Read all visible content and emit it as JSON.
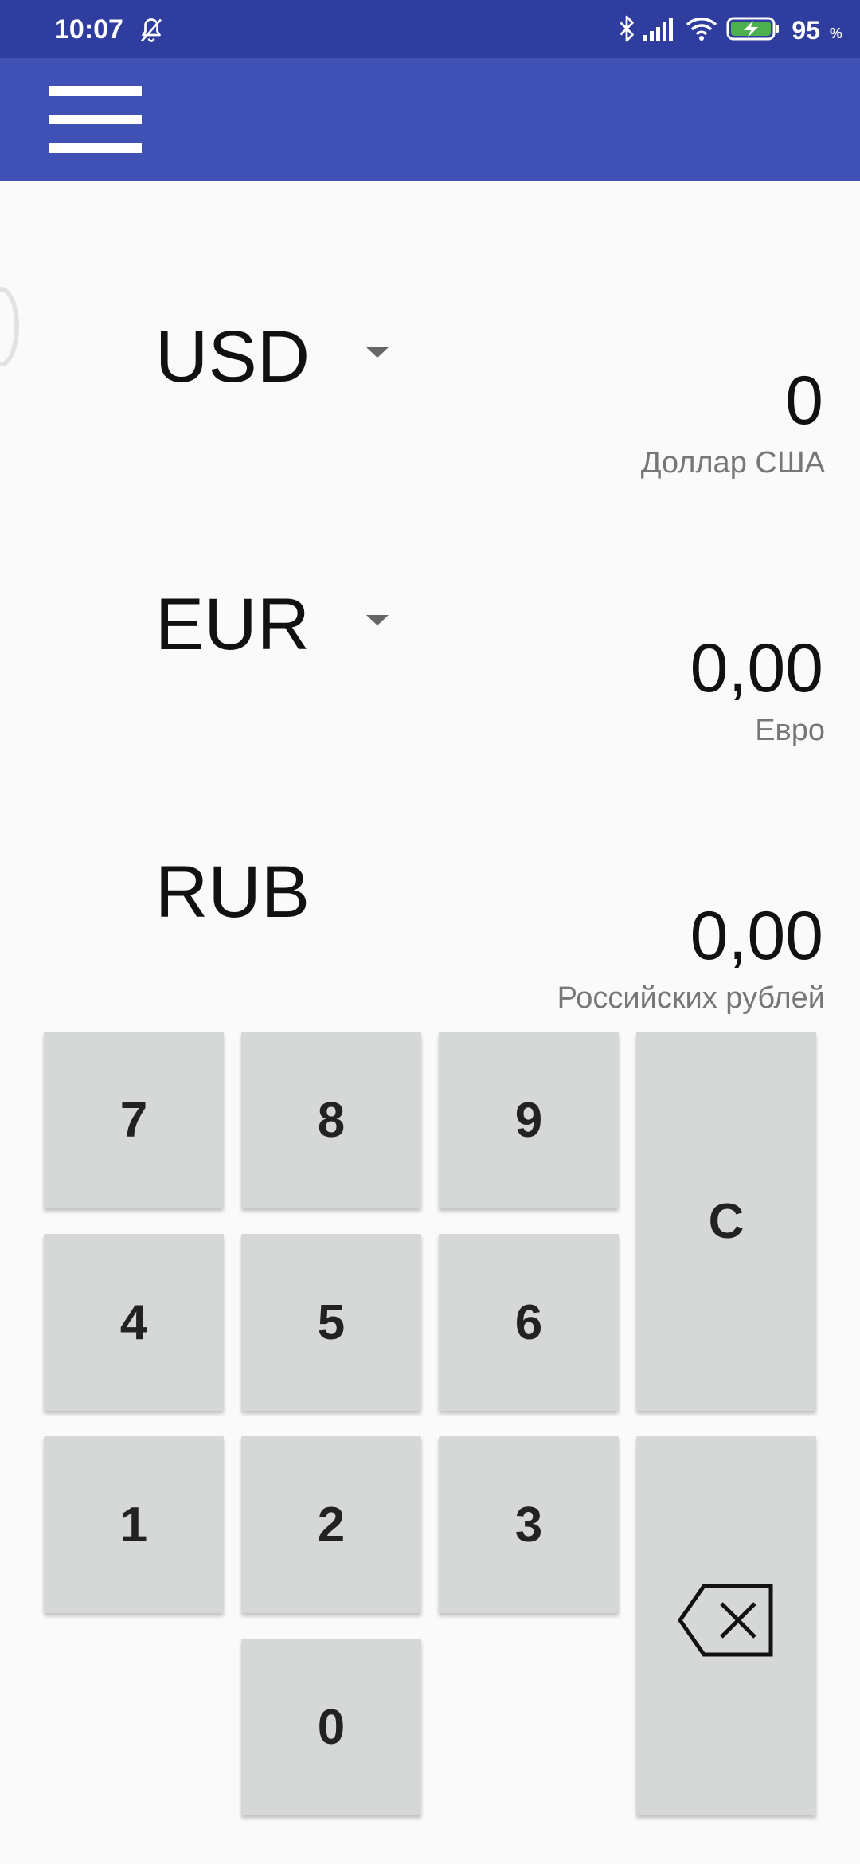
{
  "status_bar": {
    "time": "10:07",
    "battery_percent": "95",
    "battery_percent_sign": "%",
    "icons": [
      "bell-off-icon",
      "bluetooth-icon",
      "signal-icon",
      "wifi-icon",
      "battery-charging-icon"
    ]
  },
  "toolbar": {
    "menu_icon": "hamburger-menu-icon"
  },
  "currencies": [
    {
      "code": "USD",
      "amount": "0",
      "name": "Доллар США",
      "has_dropdown": true
    },
    {
      "code": "EUR",
      "amount": "0,00",
      "name": "Евро",
      "has_dropdown": true
    },
    {
      "code": "RUB",
      "amount": "0,00",
      "name": "Российских рублей",
      "has_dropdown": false
    }
  ],
  "keypad": {
    "k7": "7",
    "k8": "8",
    "k9": "9",
    "k4": "4",
    "k5": "5",
    "k6": "6",
    "k1": "1",
    "k2": "2",
    "k3": "3",
    "k0": "0",
    "clear": "C",
    "backspace_icon": "backspace-icon"
  },
  "colors": {
    "status_bar": "#2f3d9e",
    "toolbar": "#3f51b5",
    "background": "#fafafa",
    "key": "#d6d7d7"
  }
}
